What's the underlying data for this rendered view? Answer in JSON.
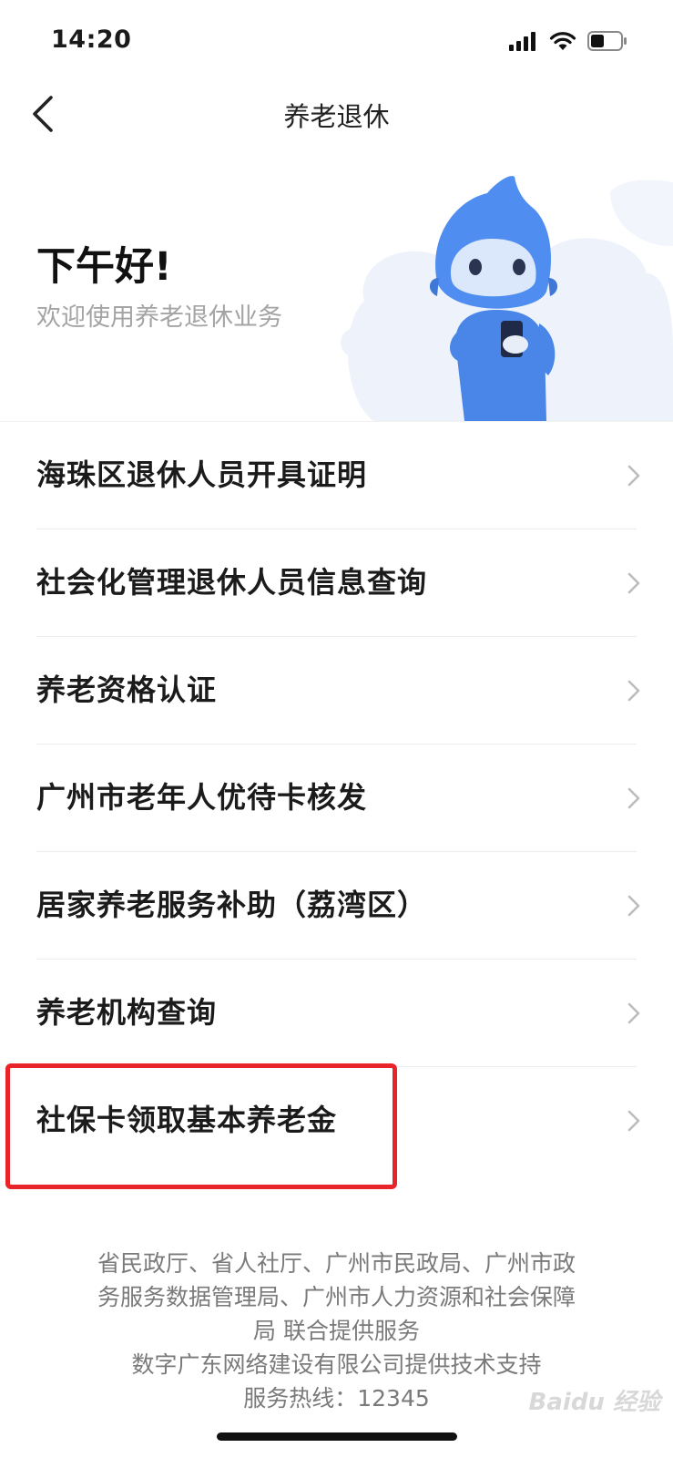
{
  "status_bar": {
    "time": "14:20"
  },
  "nav": {
    "title": "养老退休"
  },
  "hero": {
    "greeting": "下午好!",
    "subtitle": "欢迎使用养老退休业务"
  },
  "menu": [
    {
      "label": "海珠区退休人员开具证明"
    },
    {
      "label": "社会化管理退休人员信息查询"
    },
    {
      "label": "养老资格认证"
    },
    {
      "label": "广州市老年人优待卡核发"
    },
    {
      "label": "居家养老服务补助（荔湾区）"
    },
    {
      "label": "养老机构查询"
    },
    {
      "label": "社保卡领取基本养老金"
    }
  ],
  "footer": {
    "line1": "省民政厅、省人社厅、广州市民政局、广州市政",
    "line2": "务服务数据管理局、广州市人力资源和社会保障",
    "line3": "局 联合提供服务",
    "line4": "数字广东网络建设有限公司提供技术支持",
    "line5": "服务热线：12345"
  },
  "watermark": "Baidu 经验",
  "icons": [
    "signal-icon",
    "wifi-icon",
    "battery-icon",
    "back-arrow-icon",
    "chevron-right-icon"
  ],
  "colors": {
    "highlight": "#e8242a",
    "mascot_blue": "#4a86e8",
    "text_secondary": "#a4a4a4"
  }
}
